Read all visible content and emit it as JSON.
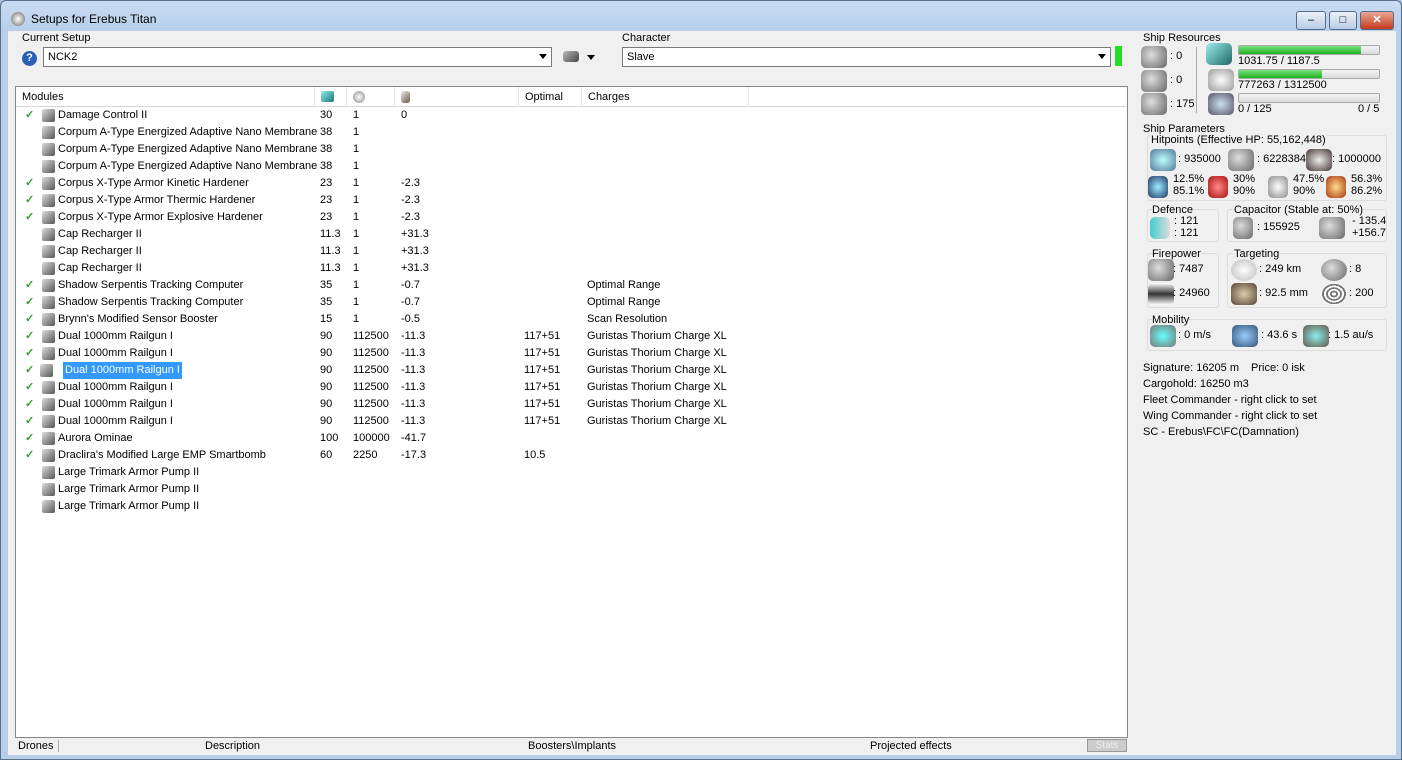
{
  "window": {
    "title": "Setups for Erebus Titan",
    "min": "–",
    "max": "□",
    "close": "✕"
  },
  "setup": {
    "label": "Current Setup",
    "value": "NCK2",
    "help": "?"
  },
  "character": {
    "label": "Character",
    "value": "Slave"
  },
  "columns": [
    "Modules",
    "",
    "",
    "",
    "Optimal",
    "Charges"
  ],
  "column_icons": [
    "cpu-icon",
    "powergrid-icon",
    "capacitor-icon"
  ],
  "modules": [
    {
      "check": true,
      "name": "Damage Control II",
      "c1": "30",
      "c2": "1",
      "c3": "0",
      "opt": "",
      "charge": ""
    },
    {
      "check": false,
      "name": "Corpum A-Type Energized Adaptive Nano Membrane",
      "c1": "38",
      "c2": "1",
      "c3": "",
      "opt": "",
      "charge": ""
    },
    {
      "check": false,
      "name": "Corpum A-Type Energized Adaptive Nano Membrane",
      "c1": "38",
      "c2": "1",
      "c3": "",
      "opt": "",
      "charge": ""
    },
    {
      "check": false,
      "name": "Corpum A-Type Energized Adaptive Nano Membrane",
      "c1": "38",
      "c2": "1",
      "c3": "",
      "opt": "",
      "charge": ""
    },
    {
      "check": true,
      "name": "Corpus X-Type Armor Kinetic Hardener",
      "c1": "23",
      "c2": "1",
      "c3": "-2.3",
      "opt": "",
      "charge": ""
    },
    {
      "check": true,
      "name": "Corpus X-Type Armor Thermic Hardener",
      "c1": "23",
      "c2": "1",
      "c3": "-2.3",
      "opt": "",
      "charge": ""
    },
    {
      "check": true,
      "name": "Corpus X-Type Armor Explosive Hardener",
      "c1": "23",
      "c2": "1",
      "c3": "-2.3",
      "opt": "",
      "charge": ""
    },
    {
      "check": false,
      "name": "Cap Recharger II",
      "c1": "11.3",
      "c2": "1",
      "c3": "+31.3",
      "opt": "",
      "charge": ""
    },
    {
      "check": false,
      "name": "Cap Recharger II",
      "c1": "11.3",
      "c2": "1",
      "c3": "+31.3",
      "opt": "",
      "charge": ""
    },
    {
      "check": false,
      "name": "Cap Recharger II",
      "c1": "11.3",
      "c2": "1",
      "c3": "+31.3",
      "opt": "",
      "charge": ""
    },
    {
      "check": true,
      "name": "Shadow Serpentis Tracking Computer",
      "c1": "35",
      "c2": "1",
      "c3": "-0.7",
      "opt": "",
      "charge": "Optimal Range"
    },
    {
      "check": true,
      "name": "Shadow Serpentis Tracking Computer",
      "c1": "35",
      "c2": "1",
      "c3": "-0.7",
      "opt": "",
      "charge": "Optimal Range"
    },
    {
      "check": true,
      "name": "Brynn's Modified Sensor Booster",
      "c1": "15",
      "c2": "1",
      "c3": "-0.5",
      "opt": "",
      "charge": "Scan Resolution"
    },
    {
      "check": true,
      "name": "Dual 1000mm Railgun I",
      "c1": "90",
      "c2": "112500",
      "c3": "-11.3",
      "opt": "117+51",
      "charge": "Guristas Thorium Charge XL"
    },
    {
      "check": true,
      "name": "Dual 1000mm Railgun I",
      "c1": "90",
      "c2": "112500",
      "c3": "-11.3",
      "opt": "117+51",
      "charge": "Guristas Thorium Charge XL"
    },
    {
      "check": true,
      "name": "Dual 1000mm Railgun I",
      "c1": "90",
      "c2": "112500",
      "c3": "-11.3",
      "opt": "117+51",
      "charge": "Guristas Thorium Charge XL",
      "selected": true
    },
    {
      "check": true,
      "name": "Dual 1000mm Railgun I",
      "c1": "90",
      "c2": "112500",
      "c3": "-11.3",
      "opt": "117+51",
      "charge": "Guristas Thorium Charge XL"
    },
    {
      "check": true,
      "name": "Dual 1000mm Railgun I",
      "c1": "90",
      "c2": "112500",
      "c3": "-11.3",
      "opt": "117+51",
      "charge": "Guristas Thorium Charge XL"
    },
    {
      "check": true,
      "name": "Dual 1000mm Railgun I",
      "c1": "90",
      "c2": "112500",
      "c3": "-11.3",
      "opt": "117+51",
      "charge": "Guristas Thorium Charge XL"
    },
    {
      "check": true,
      "name": "Aurora Ominae",
      "c1": "100",
      "c2": "100000",
      "c3": "-41.7",
      "opt": "",
      "charge": ""
    },
    {
      "check": true,
      "name": "Draclira's Modified Large EMP Smartbomb",
      "c1": "60",
      "c2": "2250",
      "c3": "-17.3",
      "opt": "10.5",
      "charge": ""
    },
    {
      "check": false,
      "name": "Large Trimark Armor Pump II",
      "c1": "",
      "c2": "",
      "c3": "",
      "opt": "",
      "charge": ""
    },
    {
      "check": false,
      "name": "Large Trimark Armor Pump II",
      "c1": "",
      "c2": "",
      "c3": "",
      "opt": "",
      "charge": ""
    },
    {
      "check": false,
      "name": "Large Trimark Armor Pump II",
      "c1": "",
      "c2": "",
      "c3": "",
      "opt": "",
      "charge": ""
    }
  ],
  "bottom_tabs": {
    "drones": "Drones",
    "description": "Description",
    "boosters": "Boosters\\Implants",
    "projected": "Projected effects",
    "stats": "Stats"
  },
  "resources": {
    "title": "Ship Resources",
    "turrets": ": 0",
    "launchers": ": 0",
    "calibration": ": 175",
    "cpu": "1031.75 / 1187.5",
    "cpu_fill": 0.869,
    "pg": "777263 / 1312500",
    "pg_fill": 0.592,
    "drone_bw": "0 / 125",
    "drone_fill": 0,
    "drones": "0 / 5"
  },
  "params": {
    "title": "Ship Parameters",
    "hp_title": "Hitpoints (Effective HP: 55,162,448)",
    "shield": ": 935000",
    "armor": ": 6228384",
    "structure": ": 1000000",
    "res": [
      [
        "12.5%",
        "85.1%"
      ],
      [
        "30%",
        "90%"
      ],
      [
        "47.5%",
        "90%"
      ],
      [
        "56.3%",
        "86.2%"
      ]
    ],
    "defence_title": "Defence",
    "def1": ": 121",
    "def2": ": 121",
    "cap_title": "Capacitor (Stable at: 50%)",
    "cap": ": 155925",
    "cap_minus": "- 135.4",
    "cap_plus": "+156.7",
    "fire_title": "Firepower",
    "dps": ": 7487",
    "volley": ": 24960",
    "target_title": "Targeting",
    "range": ": 249 km",
    "targets": ": 8",
    "scanres": ": 92.5 mm",
    "sensor": ": 200",
    "mob_title": "Mobility",
    "speed": ": 0 m/s",
    "align": ": 43.6 s",
    "warp": ": 1.5 au/s",
    "signature": "Signature: 16205 m",
    "price": "Price: 0 isk",
    "cargo": "Cargohold: 16250 m3",
    "fleet": "Fleet Commander - right click to set",
    "wing": "Wing Commander - right click to set",
    "sc": "SC - Erebus\\FC\\FC(Damnation)"
  },
  "colors": {
    "selection": "#3399ff",
    "bar": "#1fb41f",
    "status_ok": "#22dd22"
  }
}
